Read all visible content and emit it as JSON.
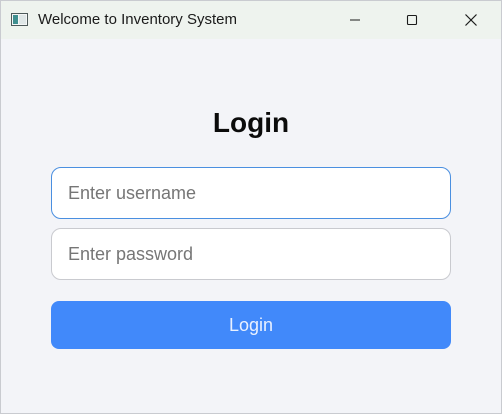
{
  "window": {
    "title": "Welcome to Inventory System",
    "icon": "app-window-icon",
    "controls": {
      "minimize": "minimize-icon",
      "maximize": "maximize-icon",
      "close": "close-icon"
    }
  },
  "login": {
    "heading": "Login",
    "username": {
      "placeholder": "Enter username",
      "value": ""
    },
    "password": {
      "placeholder": "Enter password",
      "value": ""
    },
    "button_label": "Login"
  },
  "colors": {
    "accent": "#4189fa",
    "focused_border": "#4a8fe0",
    "background": "#f3f4f8",
    "titlebar": "#eef3ee"
  }
}
